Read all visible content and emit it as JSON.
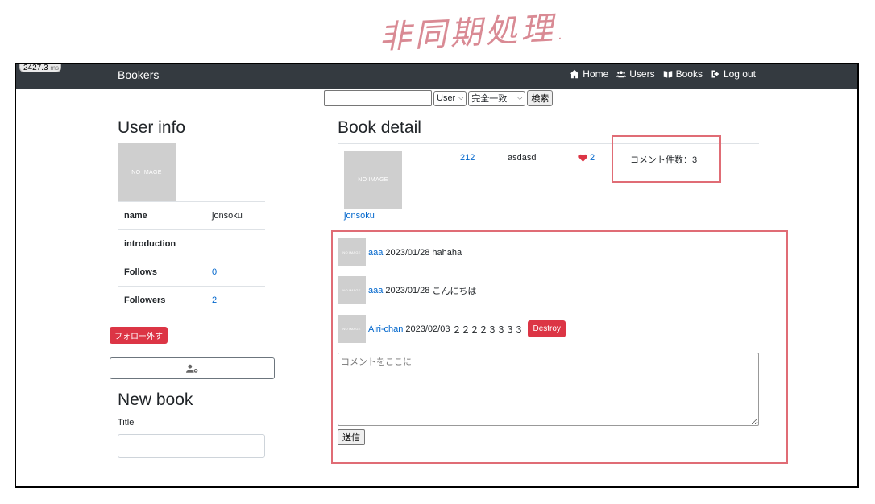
{
  "annotation": {
    "handwritten_title": "非同期処理"
  },
  "navbar": {
    "timer": "2427.3",
    "timer_unit": "ms",
    "brand": "Bookers",
    "links": [
      "Home",
      "Users",
      "Books",
      "Log out"
    ]
  },
  "search": {
    "input_value": "",
    "model_select": "User",
    "method_select": "完全一致",
    "submit_label": "検索"
  },
  "user_info": {
    "heading": "User info",
    "image_text": "NO IMAGE",
    "rows": [
      {
        "label": "name",
        "value": "jonsoku"
      },
      {
        "label": "introduction",
        "value": ""
      },
      {
        "label": "Follows",
        "value": "0"
      },
      {
        "label": "Followers",
        "value": "2"
      }
    ],
    "unfollow_label": "フォロー外す"
  },
  "new_book": {
    "heading": "New book",
    "title_label": "Title"
  },
  "book_detail": {
    "heading": "Book detail",
    "image_text": "NO IMAGE",
    "user": "jonsoku",
    "title": "212",
    "body": "asdasd",
    "favorites": "2",
    "comment_count": "コメント件数：3"
  },
  "comments": [
    {
      "avatar_text": "NO IMAGE",
      "user": "aaa",
      "date": "2023/01/28",
      "text": "hahaha",
      "destroy": ""
    },
    {
      "avatar_text": "NO IMAGE",
      "user": "aaa",
      "date": "2023/01/28",
      "text": "こんにちは",
      "destroy": ""
    },
    {
      "avatar_text": "NO IMAGE",
      "user": "Airi-chan",
      "date": "2023/02/03",
      "text": "２２２２３３３３",
      "destroy": "Destroy"
    }
  ],
  "comment_form": {
    "placeholder": "コメントをここに",
    "submit_label": "送信"
  },
  "colors": {
    "navbar": "#343a40",
    "link": "#0066cc",
    "danger": "#dc3545",
    "highlight_box": "#e06c75"
  }
}
